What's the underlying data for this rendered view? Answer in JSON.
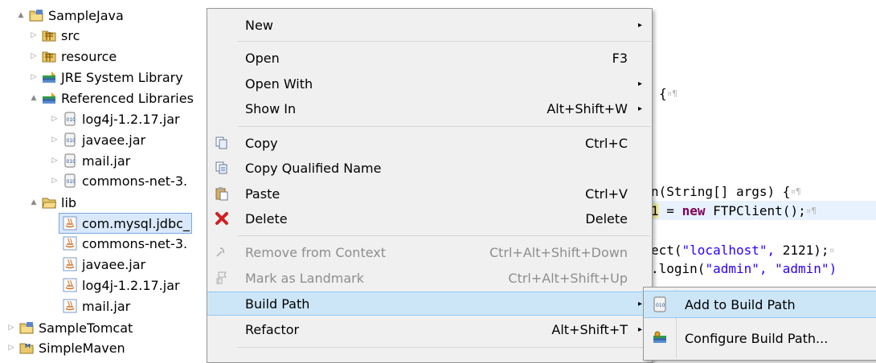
{
  "tree": {
    "items": [
      {
        "label": "SampleJava",
        "icon": "project-folder-icon",
        "arrow": "▲"
      },
      {
        "label": "src",
        "icon": "source-folder-icon",
        "arrow": "▷"
      },
      {
        "label": "resource",
        "icon": "source-folder-icon",
        "arrow": "▷"
      },
      {
        "label": "JRE System Library",
        "icon": "library-icon",
        "arrow": "▷"
      },
      {
        "label": "Referenced Libraries",
        "icon": "library-icon",
        "arrow": "▲"
      },
      {
        "label": "log4j-1.2.17.jar",
        "icon": "jar-icon",
        "arrow": "▷"
      },
      {
        "label": "javaee.jar",
        "icon": "jar-icon",
        "arrow": "▷"
      },
      {
        "label": "mail.jar",
        "icon": "jar-icon",
        "arrow": "▷"
      },
      {
        "label": "commons-net-3.",
        "icon": "jar-icon",
        "arrow": "▷"
      },
      {
        "label": "lib",
        "icon": "folder-icon",
        "arrow": "▲"
      },
      {
        "label": "com.mysql.jdbc_",
        "icon": "jar-file-icon",
        "arrow": ""
      },
      {
        "label": "commons-net-3.",
        "icon": "jar-file-icon",
        "arrow": ""
      },
      {
        "label": "javaee.jar",
        "icon": "jar-file-icon",
        "arrow": ""
      },
      {
        "label": "log4j-1.2.17.jar",
        "icon": "jar-file-icon",
        "arrow": ""
      },
      {
        "label": "mail.jar",
        "icon": "jar-file-icon",
        "arrow": ""
      },
      {
        "label": "SampleTomcat",
        "icon": "project-folder-icon",
        "arrow": "▷"
      },
      {
        "label": "SimpleMaven",
        "icon": "maven-project-icon",
        "arrow": "▷"
      }
    ]
  },
  "editor": {
    "line1": {
      "text": "{",
      "ws": "¤¶"
    },
    "line2": {
      "pre": "n(String[]",
      "mid": "args)",
      "post": "{",
      "ws": "¤¶"
    },
    "line3": {
      "pre": "1",
      "eq": "=",
      "kw": "new",
      "post": "FTPClient();",
      "ws": "¤¶"
    },
    "line4": {
      "pre": "ect(",
      "str": "\"localhost\",",
      "post": "2121);",
      "ws": "¤"
    },
    "line5": {
      "pre": ".login(",
      "str1": "\"admin\",",
      "str2": "\"admin\")"
    }
  },
  "menu": {
    "items": [
      {
        "label": "New",
        "shortcut": "",
        "submenu": "▸"
      },
      {
        "label": "Open",
        "shortcut": "F3",
        "submenu": ""
      },
      {
        "label": "Open With",
        "shortcut": "",
        "submenu": "▸"
      },
      {
        "label": "Show In",
        "shortcut": "Alt+Shift+W",
        "submenu": "▸"
      },
      {
        "label": "Copy",
        "shortcut": "Ctrl+C",
        "submenu": ""
      },
      {
        "label": "Copy Qualified Name",
        "shortcut": "",
        "submenu": ""
      },
      {
        "label": "Paste",
        "shortcut": "Ctrl+V",
        "submenu": ""
      },
      {
        "label": "Delete",
        "shortcut": "Delete",
        "submenu": ""
      },
      {
        "label": "Remove from Context",
        "shortcut": "Ctrl+Alt+Shift+Down",
        "submenu": ""
      },
      {
        "label": "Mark as Landmark",
        "shortcut": "Ctrl+Alt+Shift+Up",
        "submenu": ""
      },
      {
        "label": "Build Path",
        "shortcut": "",
        "submenu": "▸"
      },
      {
        "label": "Refactor",
        "shortcut": "Alt+Shift+T",
        "submenu": "▸"
      }
    ]
  },
  "submenu": {
    "items": [
      {
        "label": "Add to Build Path"
      },
      {
        "label": "Configure Build Path..."
      }
    ]
  },
  "colors": {
    "selection": "#cde6f7",
    "keyword": "#7f0055",
    "string": "#2a00ff"
  }
}
